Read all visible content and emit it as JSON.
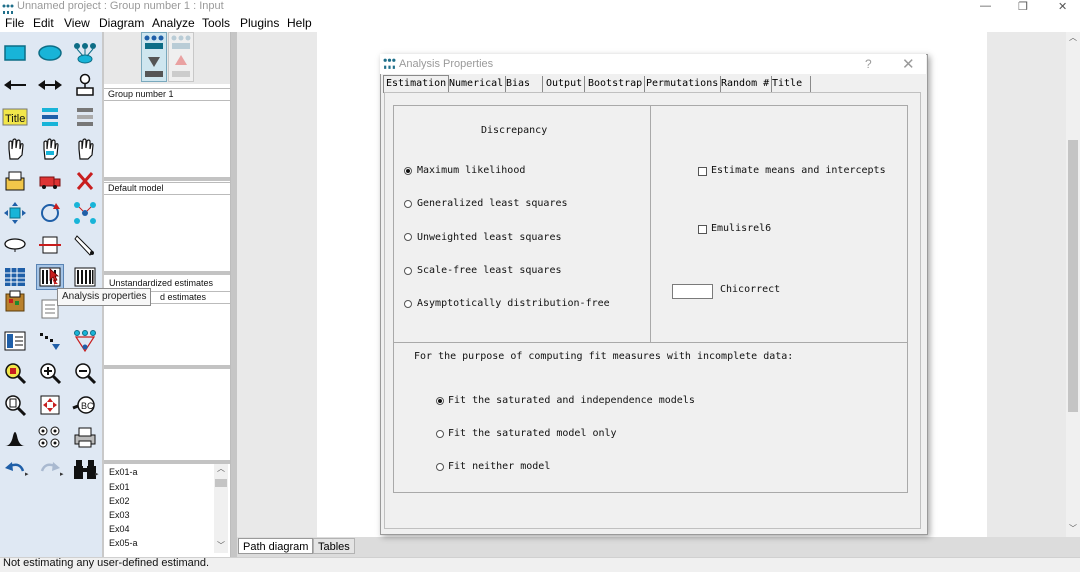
{
  "app": {
    "title": "Unnamed project : Group number 1 : Input",
    "window_controls": {
      "minimize": "—",
      "maximize": "❐",
      "close": "✕"
    }
  },
  "menu": [
    "File",
    "Edit",
    "View",
    "Diagram",
    "Analyze",
    "Tools",
    "Plugins",
    "Help"
  ],
  "panels": {
    "groups_item": "Group number 1",
    "model_item": "Default model",
    "estimates_item_1": "Unstandardized estimates",
    "estimates_item_2": "d estimates",
    "files": [
      "Ex01-a",
      "Ex01",
      "Ex02",
      "Ex03",
      "Ex04",
      "Ex05-a"
    ]
  },
  "tooltip": "Analysis properties",
  "canvas_tabs": [
    "Path diagram",
    "Tables"
  ],
  "status": "Not estimating any user-defined estimand.",
  "dialog": {
    "title": "Analysis Properties",
    "help": "?",
    "close": "✕",
    "tabs": [
      "Estimation",
      "Numerical",
      "Bias",
      "Output",
      "Bootstrap",
      "Permutations",
      "Random #",
      "Title"
    ],
    "discrepancy_heading": "Discrepancy",
    "discrepancy_options": [
      {
        "label": "Maximum likelihood",
        "selected": true
      },
      {
        "label": "Generalized least squares",
        "selected": false
      },
      {
        "label": "Unweighted least squares",
        "selected": false
      },
      {
        "label": "Scale-free least squares",
        "selected": false
      },
      {
        "label": "Asymptotically distribution-free",
        "selected": false
      }
    ],
    "estimate_means": {
      "label": "Estimate means and intercepts",
      "checked": false
    },
    "emulisrel": {
      "label": "Emulisrel6",
      "checked": false
    },
    "chicorrect": {
      "label": "Chicorrect",
      "value": ""
    },
    "fit_heading": "For the purpose of computing fit measures with incomplete data:",
    "fit_options": [
      {
        "label": "Fit the saturated and independence models",
        "selected": true
      },
      {
        "label": "Fit the saturated model only",
        "selected": false
      },
      {
        "label": "Fit neither model",
        "selected": false
      }
    ]
  },
  "colors": {
    "toolbox_bg": "#dfe8f3",
    "tool_cyan": "#18a9c9",
    "tool_blue": "#1f5fa8"
  }
}
